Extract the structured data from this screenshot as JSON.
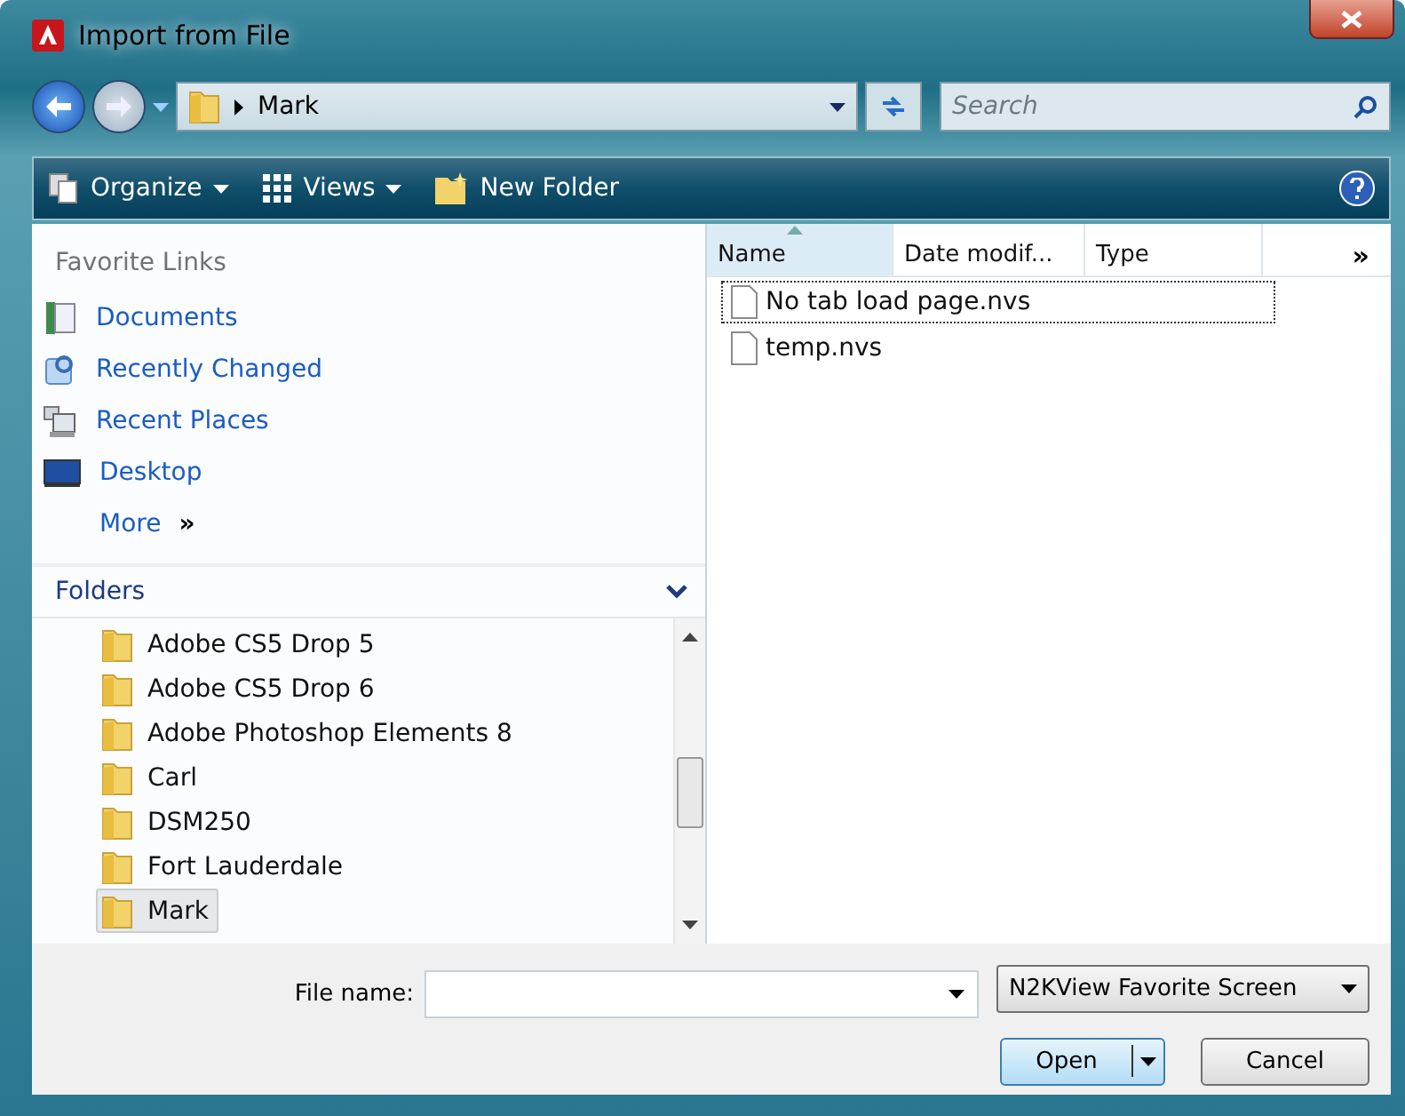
{
  "window": {
    "title": "Import from File"
  },
  "address": {
    "path": "Mark",
    "search_placeholder": "Search"
  },
  "toolbar": {
    "items": [
      {
        "label": "Organize",
        "kind": "menu"
      },
      {
        "label": "Views",
        "kind": "menu"
      },
      {
        "label": "New Folder",
        "kind": "plain"
      }
    ]
  },
  "favorite_links": {
    "title": "Favorite Links",
    "items": [
      {
        "label": "Documents",
        "kind": "documents"
      },
      {
        "label": "Recently Changed",
        "kind": "recent"
      },
      {
        "label": "Recent Places",
        "kind": "places"
      },
      {
        "label": "Desktop",
        "kind": "desktop"
      }
    ],
    "more": "More",
    "more_glyph": "»"
  },
  "folders": {
    "title": "Folders",
    "items": [
      {
        "label": "Adobe CS5 Drop 5",
        "selected": false
      },
      {
        "label": "Adobe CS5 Drop 6",
        "selected": false
      },
      {
        "label": "Adobe Photoshop Elements 8",
        "selected": false
      },
      {
        "label": "Carl",
        "selected": false
      },
      {
        "label": "DSM250",
        "selected": false
      },
      {
        "label": "Fort Lauderdale",
        "selected": false
      },
      {
        "label": "Mark",
        "selected": true
      }
    ]
  },
  "file_list": {
    "columns": [
      {
        "label": "Name",
        "selected": true
      },
      {
        "label": "Date modif...",
        "selected": false
      },
      {
        "label": "Type",
        "selected": false
      }
    ],
    "overflow_glyph": "»",
    "files": [
      {
        "name": "No tab load page.nvs",
        "selected": true
      },
      {
        "name": "temp.nvs",
        "selected": false
      }
    ]
  },
  "footer": {
    "file_name_label": "File name:",
    "file_type": "N2KView Favorite Screen",
    "buttons": [
      {
        "label": "Open",
        "kind": "split"
      },
      {
        "label": "Cancel",
        "kind": "plain"
      }
    ]
  }
}
